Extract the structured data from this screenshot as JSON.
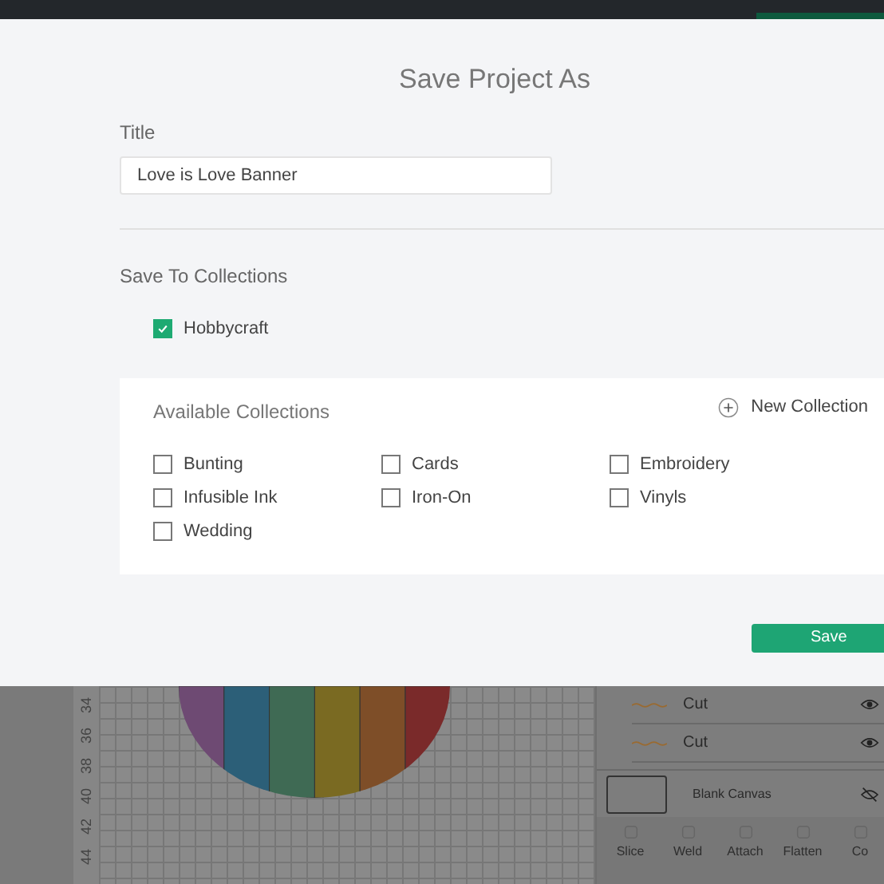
{
  "dialog": {
    "title": "Save Project As",
    "title_field": {
      "label": "Title",
      "value": "Love is Love Banner"
    },
    "save_to": {
      "label": "Save To Collections",
      "items": [
        {
          "label": "Hobbycraft",
          "checked": true
        }
      ]
    },
    "available": {
      "label": "Available Collections",
      "new_collection": "New Collection",
      "items": [
        {
          "label": "Bunting",
          "checked": false
        },
        {
          "label": "Cards",
          "checked": false
        },
        {
          "label": "Embroidery",
          "checked": false
        },
        {
          "label": "Infusible Ink",
          "checked": false
        },
        {
          "label": "Iron-On",
          "checked": false
        },
        {
          "label": "Vinyls",
          "checked": false
        },
        {
          "label": "Wedding",
          "checked": false
        }
      ]
    },
    "save_button": "Save"
  },
  "canvas": {
    "ruler": [
      "34",
      "36",
      "38",
      "40",
      "42",
      "44"
    ]
  },
  "layers": {
    "items": [
      {
        "label": "Cut"
      },
      {
        "label": "Cut"
      }
    ],
    "canvas_label": "Blank Canvas"
  },
  "toolbar": [
    "Slice",
    "Weld",
    "Attach",
    "Flatten",
    "Co"
  ]
}
